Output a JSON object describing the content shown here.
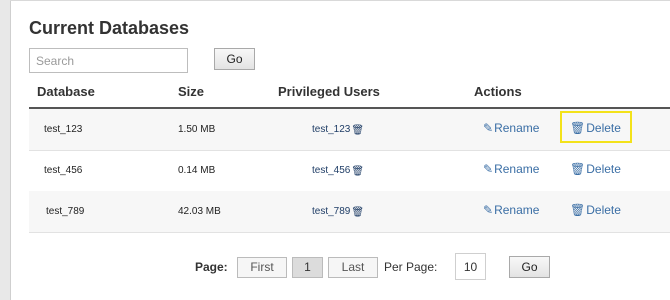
{
  "page": {
    "title": "Current Databases"
  },
  "search": {
    "placeholder": "Search",
    "go_label": "Go"
  },
  "table": {
    "headers": {
      "database": "Database",
      "size": "Size",
      "users": "Privileged Users",
      "actions": "Actions"
    },
    "rows": [
      {
        "database": "test_123",
        "size": "1.50 MB",
        "user": "test_123",
        "rename": "Rename",
        "delete": "Delete"
      },
      {
        "database": "test_456",
        "size": "0.14 MB",
        "user": "test_456",
        "rename": "Rename",
        "delete": "Delete"
      },
      {
        "database": "test_789",
        "size": "42.03 MB",
        "user": "test_789",
        "rename": "Rename",
        "delete": "Delete"
      }
    ]
  },
  "pagination": {
    "page_label": "Page:",
    "first": "First",
    "current": "1",
    "last": "Last",
    "per_page_label": "Per Page:",
    "per_page_value": "10",
    "go_label": "Go"
  },
  "icons": {
    "pencil": "pencil-icon",
    "trash": "trash-icon"
  },
  "colors": {
    "link": "#3a6ea5",
    "highlight": "#f3e21a"
  }
}
